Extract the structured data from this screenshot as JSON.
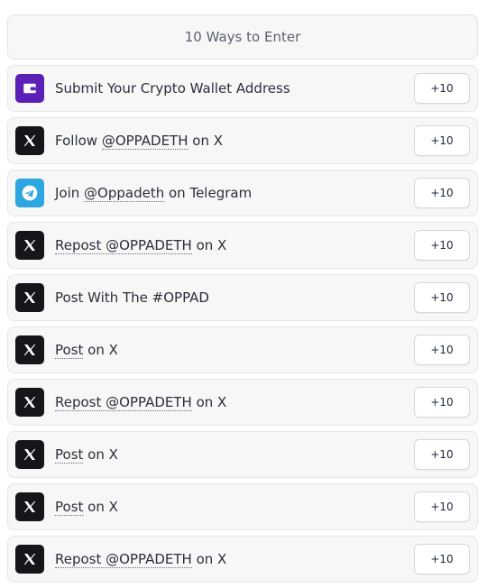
{
  "header": {
    "title": "10 Ways to Enter"
  },
  "entries": [
    {
      "icon": "wallet-icon",
      "parts": [
        {
          "t": "Submit Your Crypto Wallet Address",
          "u": false
        }
      ],
      "points": "+10"
    },
    {
      "icon": "x-logo-icon",
      "parts": [
        {
          "t": "Follow ",
          "u": false
        },
        {
          "t": "@OPPADETH",
          "u": true
        },
        {
          "t": " on X",
          "u": false
        }
      ],
      "points": "+10"
    },
    {
      "icon": "telegram-icon",
      "parts": [
        {
          "t": "Join ",
          "u": false
        },
        {
          "t": "@Oppadeth",
          "u": true
        },
        {
          "t": " on Telegram",
          "u": false
        }
      ],
      "points": "+10"
    },
    {
      "icon": "x-logo-icon",
      "parts": [
        {
          "t": "Repost @OPPADETH",
          "u": true
        },
        {
          "t": " on X",
          "u": false
        }
      ],
      "points": "+10"
    },
    {
      "icon": "x-logo-icon",
      "parts": [
        {
          "t": "Post With The #OPPAD",
          "u": false
        }
      ],
      "points": "+10"
    },
    {
      "icon": "x-logo-icon",
      "parts": [
        {
          "t": "Post",
          "u": true
        },
        {
          "t": " on X",
          "u": false
        }
      ],
      "points": "+10"
    },
    {
      "icon": "x-logo-icon",
      "parts": [
        {
          "t": "Repost @OPPADETH",
          "u": true
        },
        {
          "t": " on X",
          "u": false
        }
      ],
      "points": "+10"
    },
    {
      "icon": "x-logo-icon",
      "parts": [
        {
          "t": "Post",
          "u": true
        },
        {
          "t": " on X",
          "u": false
        }
      ],
      "points": "+10"
    },
    {
      "icon": "x-logo-icon",
      "parts": [
        {
          "t": "Post",
          "u": true
        },
        {
          "t": " on X",
          "u": false
        }
      ],
      "points": "+10"
    },
    {
      "icon": "x-logo-icon",
      "parts": [
        {
          "t": "Repost @OPPADETH",
          "u": true
        },
        {
          "t": " on X",
          "u": false
        }
      ],
      "points": "+10"
    }
  ]
}
